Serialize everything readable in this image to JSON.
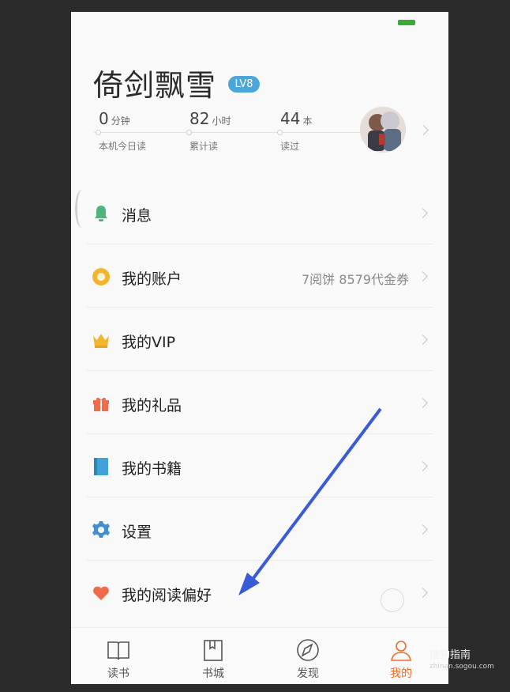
{
  "profile": {
    "name": "倚剑飘雪",
    "level": "LV8",
    "stats": [
      {
        "value": "0",
        "unit": "分钟",
        "label": "本机今日读"
      },
      {
        "value": "82",
        "unit": "小时",
        "label": "累计读"
      },
      {
        "value": "44",
        "unit": "本",
        "label": "读过"
      }
    ]
  },
  "menu": [
    {
      "label": "消息",
      "icon": "bell-icon",
      "extra": ""
    },
    {
      "label": "我的账户",
      "icon": "coin-icon",
      "extra": "7阅饼   8579代金券"
    },
    {
      "label": "我的VIP",
      "icon": "crown-icon",
      "extra": ""
    },
    {
      "label": "我的礼品",
      "icon": "gift-icon",
      "extra": ""
    },
    {
      "label": "我的书籍",
      "icon": "book-icon",
      "extra": ""
    },
    {
      "label": "设置",
      "icon": "gear-icon",
      "extra": ""
    },
    {
      "label": "我的阅读偏好",
      "icon": "heart-icon",
      "extra": ""
    }
  ],
  "tabs": [
    {
      "label": "读书",
      "icon": "open-book-icon",
      "active": false
    },
    {
      "label": "书城",
      "icon": "bookmark-book-icon",
      "active": false
    },
    {
      "label": "发现",
      "icon": "compass-icon",
      "active": false
    },
    {
      "label": "我的",
      "icon": "person-icon",
      "active": true
    }
  ],
  "colors": {
    "accent": "#f06a2c",
    "level_badge": "#4ba7d9",
    "annotation_arrow": "#3a5bd6"
  },
  "watermark": {
    "brand": "搜狗指南",
    "url": "zhinan.sogou.com"
  }
}
